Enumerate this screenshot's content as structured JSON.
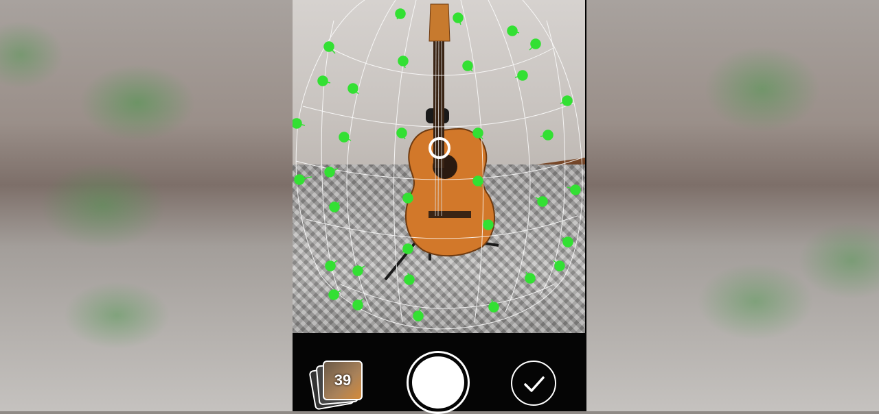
{
  "capture": {
    "photo_count": "39",
    "accent_color": "#33e033",
    "grid_color": "#ffffff"
  },
  "icons": {
    "gallery": "photo-stack-icon",
    "shutter": "shutter-button",
    "done": "checkmark-icon",
    "guitar": "guitar-object"
  }
}
